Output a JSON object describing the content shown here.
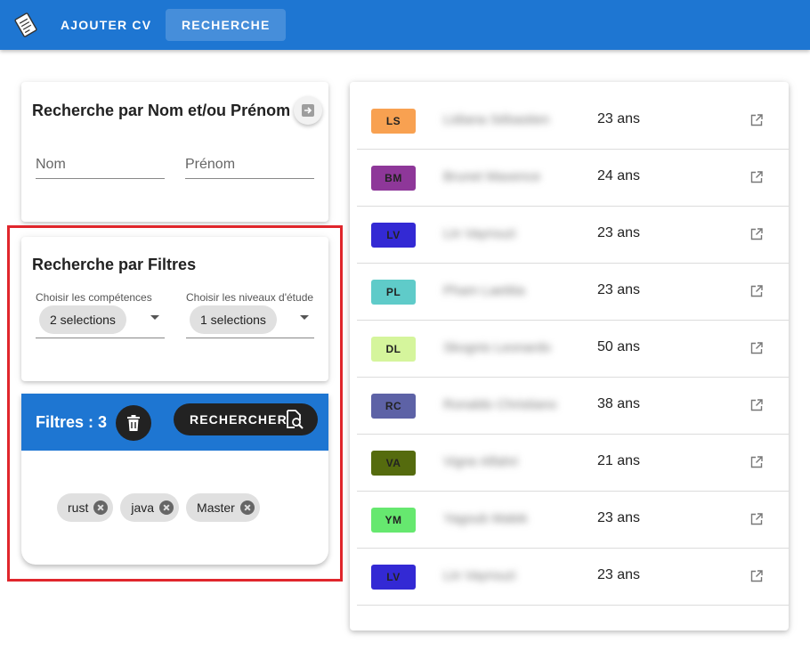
{
  "appbar": {
    "logo_icon": "cv-document-icon",
    "nav": {
      "add_cv": "AJOUTER CV",
      "search": "RECHERCHE"
    }
  },
  "name_search": {
    "title": "Recherche par Nom et/ou Prénom",
    "go_icon": "arrow-right-icon",
    "nom_placeholder": "Nom",
    "prenom_placeholder": "Prénom"
  },
  "filter_search": {
    "title": "Recherche par Filtres",
    "skills": {
      "label": "Choisir les compétences",
      "value": "2 selections"
    },
    "levels": {
      "label": "Choisir les niveaux d'étude",
      "value": "1 selections"
    }
  },
  "active_filters": {
    "count_label": "Filtres : 3",
    "delete_icon": "trash-icon",
    "search_button": "RECHERCHER",
    "search_icon": "document-search-icon",
    "chips": [
      "rust",
      "java",
      "Master"
    ]
  },
  "results": [
    {
      "initials": "LS",
      "color": "#f8a151",
      "name": "Lidiana Sébastien",
      "age": "23 ans"
    },
    {
      "initials": "BM",
      "color": "#8e3799",
      "name": "Brunet Maxence",
      "age": "24 ans"
    },
    {
      "initials": "LV",
      "color": "#3329d4",
      "name": "Lin Vayrouzi",
      "age": "23 ans"
    },
    {
      "initials": "PL",
      "color": "#5fcbc9",
      "name": "Pham Laetitia",
      "age": "23 ans"
    },
    {
      "initials": "DL",
      "color": "#d5f59c",
      "name": "Skognis Leonardo",
      "age": "50 ans"
    },
    {
      "initials": "RC",
      "color": "#5d62a6",
      "name": "Ronaldo Christiano",
      "age": "38 ans"
    },
    {
      "initials": "VA",
      "color": "#556b0e",
      "name": "Vigne Alfahri",
      "age": "21 ans"
    },
    {
      "initials": "YM",
      "color": "#66e86f",
      "name": "Yagoub Malek",
      "age": "23 ans"
    },
    {
      "initials": "LV",
      "color": "#3329d4",
      "name": "Lin Vayrouzi",
      "age": "23 ans"
    }
  ],
  "row_icon": "external-link-icon"
}
